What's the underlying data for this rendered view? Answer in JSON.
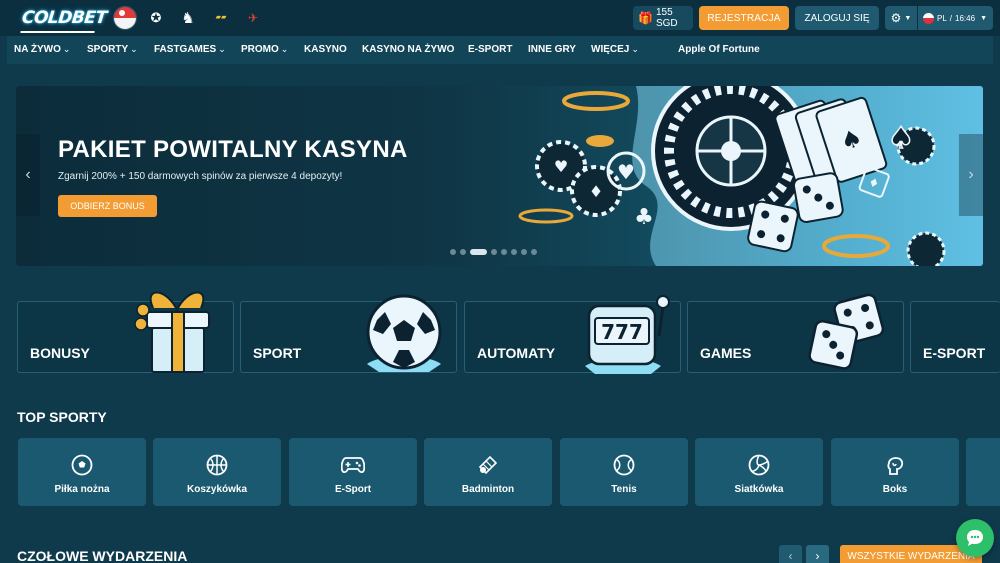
{
  "brand": {
    "logo_text": "COLDBET"
  },
  "partners": [
    "singapore-flag-icon",
    "champions-league-icon",
    "premier-league-icon",
    "crash-game-icon",
    "plane-icon"
  ],
  "header": {
    "balance": "155 SGD",
    "register_label": "REJESTRACJA",
    "login_label": "ZALOGUJ SIĘ",
    "language": "PL",
    "time": "16:46"
  },
  "nav": {
    "items": [
      {
        "label": "NA ŻYWO",
        "dropdown": true
      },
      {
        "label": "SPORTY",
        "dropdown": true
      },
      {
        "label": "FASTGAMES",
        "dropdown": true
      },
      {
        "label": "PROMO",
        "dropdown": true
      },
      {
        "label": "KASYNO",
        "dropdown": false
      },
      {
        "label": "KASYNO NA ŻYWO",
        "dropdown": false
      },
      {
        "label": "E-SPORT",
        "dropdown": false
      },
      {
        "label": "INNE GRY",
        "dropdown": false
      },
      {
        "label": "WIĘCEJ",
        "dropdown": true
      }
    ],
    "app_label": "Apple Of Fortune"
  },
  "hero": {
    "title": "PAKIET POWITALNY KASYNA",
    "subtitle": "Zgarnij 200% + 150 darmowych spinów za pierwsze 4 depozyty!",
    "cta_label": "ODBIERZ BONUS",
    "slide_count": 8,
    "active_slide": 3
  },
  "categories": [
    {
      "label": "BONUSY",
      "icon": "gift-icon"
    },
    {
      "label": "SPORT",
      "icon": "soccer-ball-icon"
    },
    {
      "label": "AUTOMATY",
      "icon": "slot-machine-icon"
    },
    {
      "label": "GAMES",
      "icon": "dice-icon"
    },
    {
      "label": "E-SPORT",
      "icon": "esport-icon"
    }
  ],
  "top_sports": {
    "title": "TOP SPORTY",
    "items": [
      {
        "label": "Piłka nożna",
        "icon": "soccer-icon"
      },
      {
        "label": "Koszykówka",
        "icon": "basketball-icon"
      },
      {
        "label": "E-Sport",
        "icon": "gamepad-icon"
      },
      {
        "label": "Badminton",
        "icon": "shuttlecock-icon"
      },
      {
        "label": "Tenis",
        "icon": "tennis-ball-icon"
      },
      {
        "label": "Siatkówka",
        "icon": "volleyball-icon"
      },
      {
        "label": "Boks",
        "icon": "boxing-glove-icon"
      }
    ]
  },
  "top_events": {
    "title": "CZOŁOWE WYDARZENIA",
    "all_label": "WSZYSTKIE WYDARZENIA"
  },
  "colors": {
    "background": "#0f3a4c",
    "topbar": "#0b2f3f",
    "accent_orange": "#f39c33",
    "tile": "#1b5970",
    "chat_green": "#2dbf6a"
  }
}
